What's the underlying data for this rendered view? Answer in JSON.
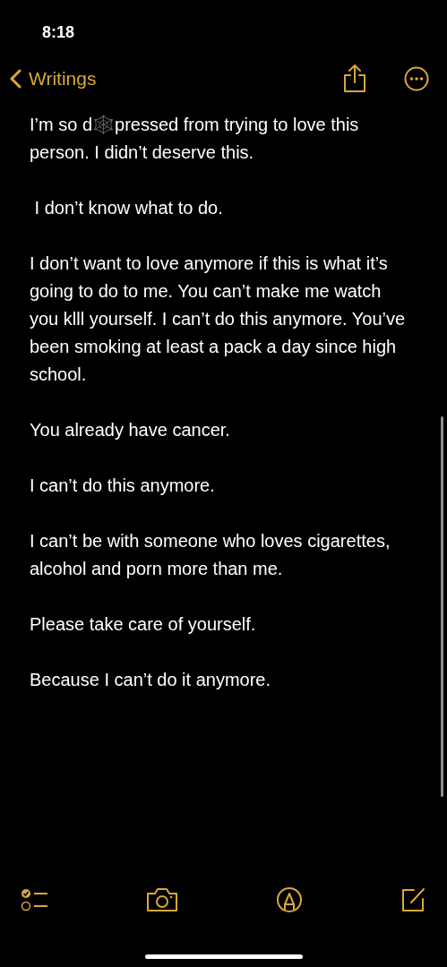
{
  "status_bar": {
    "time": "8:18"
  },
  "nav": {
    "back_label": "Writings"
  },
  "note": {
    "paragraphs": [
      "I’m so d🕸️pressed from trying to love this person. I didn’t deserve this.",
      " I don’t know what to do.",
      "I don’t want to love anymore if this is what it’s going to do to me. You can’t make me watch you klll yourself. I can’t do this anymore. You’ve been smoking at least a pack a day since high school.",
      "You already have cancer.",
      "I can’t do this anymore.",
      "I can’t be with someone who loves cigarettes, alcohol and porn more than me.",
      "Please take care of yourself.",
      "Because I can’t do it anymore."
    ]
  }
}
